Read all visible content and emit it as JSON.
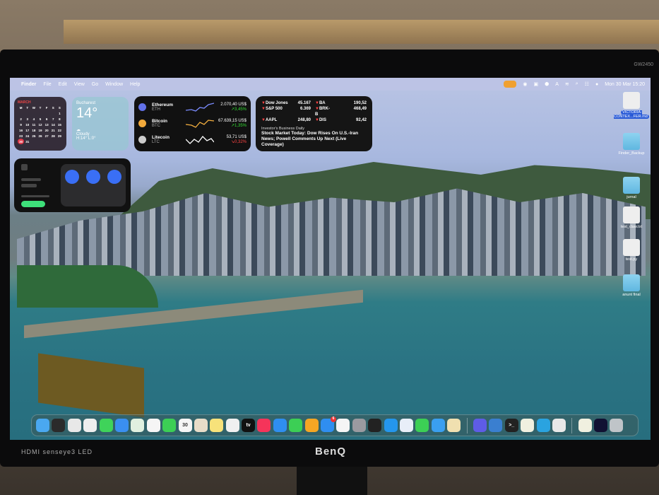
{
  "monitor": {
    "model": "GW2450",
    "left_brand": "HDMI senseye3 LED",
    "brand": "BenQ"
  },
  "menubar": {
    "apple": "",
    "items": [
      "Finder",
      "File",
      "Edit",
      "View",
      "Go",
      "Window",
      "Help"
    ],
    "datetime": "Mon 30 Mar  15:20"
  },
  "calendar": {
    "month": "MARCH",
    "weekdays": [
      "M",
      "T",
      "W",
      "T",
      "F",
      "S",
      "S"
    ],
    "rows": [
      [
        "",
        "",
        "",
        "",
        "",
        "",
        "1"
      ],
      [
        "2",
        "3",
        "4",
        "5",
        "6",
        "7",
        "8"
      ],
      [
        "9",
        "10",
        "11",
        "12",
        "13",
        "14",
        "15"
      ],
      [
        "16",
        "17",
        "18",
        "19",
        "20",
        "21",
        "22"
      ],
      [
        "23",
        "24",
        "25",
        "26",
        "27",
        "28",
        "29"
      ],
      [
        "30",
        "31",
        "",
        "",
        "",
        "",
        ""
      ]
    ],
    "today": "30"
  },
  "weather": {
    "city": "Bucharest",
    "temp": "14°",
    "condition": "Cloudy",
    "range": "H:14° L:0°"
  },
  "crypto": [
    {
      "name": "Ethereum",
      "symbol": "ETH",
      "price": "2.070,40 US$",
      "change": "↗3,45%",
      "trend": "up",
      "color": "#6271e8",
      "spark": "#7b8cff"
    },
    {
      "name": "Bitcoin",
      "symbol": "BTC",
      "price": "67.639,15 US$",
      "change": "↗1,35%",
      "trend": "up",
      "color": "#f2a93b",
      "spark": "#f5b040"
    },
    {
      "name": "Litecoin",
      "symbol": "LTC",
      "price": "53,71 US$",
      "change": "↘0,32%",
      "trend": "down",
      "color": "#cccccc",
      "spark": "#ffffff"
    }
  ],
  "stocks": {
    "rows": [
      [
        "Dow Jones",
        "45.167",
        "BA",
        "190,52"
      ],
      [
        "S&P 500",
        "6.369",
        "BRK-B",
        "468,49"
      ],
      [
        "AAPL",
        "248,80",
        "DIS",
        "92,42"
      ]
    ],
    "news_source": "Investor's Business Daily",
    "headline": "Stock Market Today: Dow Rises On U.S.-Iran News; Powell Comments Up Next (Live Coverage)"
  },
  "desktop_icons": [
    {
      "label": "VICTORIA-CONTEX...FER.md",
      "kind": "doc",
      "selected": true
    },
    {
      "label": "Finder_Backup",
      "kind": "folder"
    },
    {
      "label": "jurnal",
      "kind": "folder"
    },
    {
      "label": "test_claw.txt",
      "kind": "doc"
    },
    {
      "label": "test.py",
      "kind": "doc"
    },
    {
      "label": "anunt final",
      "kind": "folder"
    }
  ],
  "dock": [
    {
      "name": "finder",
      "color": "#4aa8f0"
    },
    {
      "name": "activity-monitor",
      "color": "#2b2b2b"
    },
    {
      "name": "chrome",
      "color": "#e8e8e8"
    },
    {
      "name": "launchpad",
      "color": "#eeeeee"
    },
    {
      "name": "messages",
      "color": "#3fd35a"
    },
    {
      "name": "mail",
      "color": "#3a8ff0"
    },
    {
      "name": "maps",
      "color": "#e0f0e0"
    },
    {
      "name": "photos",
      "color": "#f5f5f5"
    },
    {
      "name": "facetime",
      "color": "#3ccf55"
    },
    {
      "name": "calendar",
      "color": "#f5f5f5",
      "text": "30"
    },
    {
      "name": "contacts",
      "color": "#e8dcc8"
    },
    {
      "name": "notes",
      "color": "#f7e27a"
    },
    {
      "name": "freeform",
      "color": "#f0f0f0"
    },
    {
      "name": "apple-tv",
      "color": "#111111",
      "text": "tv"
    },
    {
      "name": "music",
      "color": "#f5345a"
    },
    {
      "name": "keynote",
      "color": "#2f8ef0"
    },
    {
      "name": "numbers",
      "color": "#3ccf55"
    },
    {
      "name": "pages",
      "color": "#f5a623"
    },
    {
      "name": "app-store",
      "color": "#2f8ef0",
      "badge": "6"
    },
    {
      "name": "reminders",
      "color": "#f5f5f5"
    },
    {
      "name": "system-settings",
      "color": "#9a9aa0"
    },
    {
      "name": "sketchup",
      "color": "#222222"
    },
    {
      "name": "docker",
      "color": "#2496ed"
    },
    {
      "name": "preview",
      "color": "#e8eef8"
    },
    {
      "name": "whatsapp",
      "color": "#3ccf55"
    },
    {
      "name": "safari",
      "color": "#3a9ff0"
    },
    {
      "name": "script-editor",
      "color": "#f0e0b0"
    },
    {
      "sep": true
    },
    {
      "name": "linear",
      "color": "#5e5ce6"
    },
    {
      "name": "app-cleaner",
      "color": "#3a7fd0"
    },
    {
      "name": "terminal",
      "color": "#222222",
      "text": ">_"
    },
    {
      "name": "textedit",
      "color": "#f0f0e0"
    },
    {
      "name": "telegram",
      "color": "#2aa3e0"
    },
    {
      "name": "chrome-2",
      "color": "#e8e8e8"
    },
    {
      "sep": true
    },
    {
      "name": "document-stack",
      "color": "#f0f0e0"
    },
    {
      "name": "screenshot-stack",
      "color": "#111133"
    },
    {
      "name": "trash",
      "color": "#bfc4c8"
    }
  ]
}
